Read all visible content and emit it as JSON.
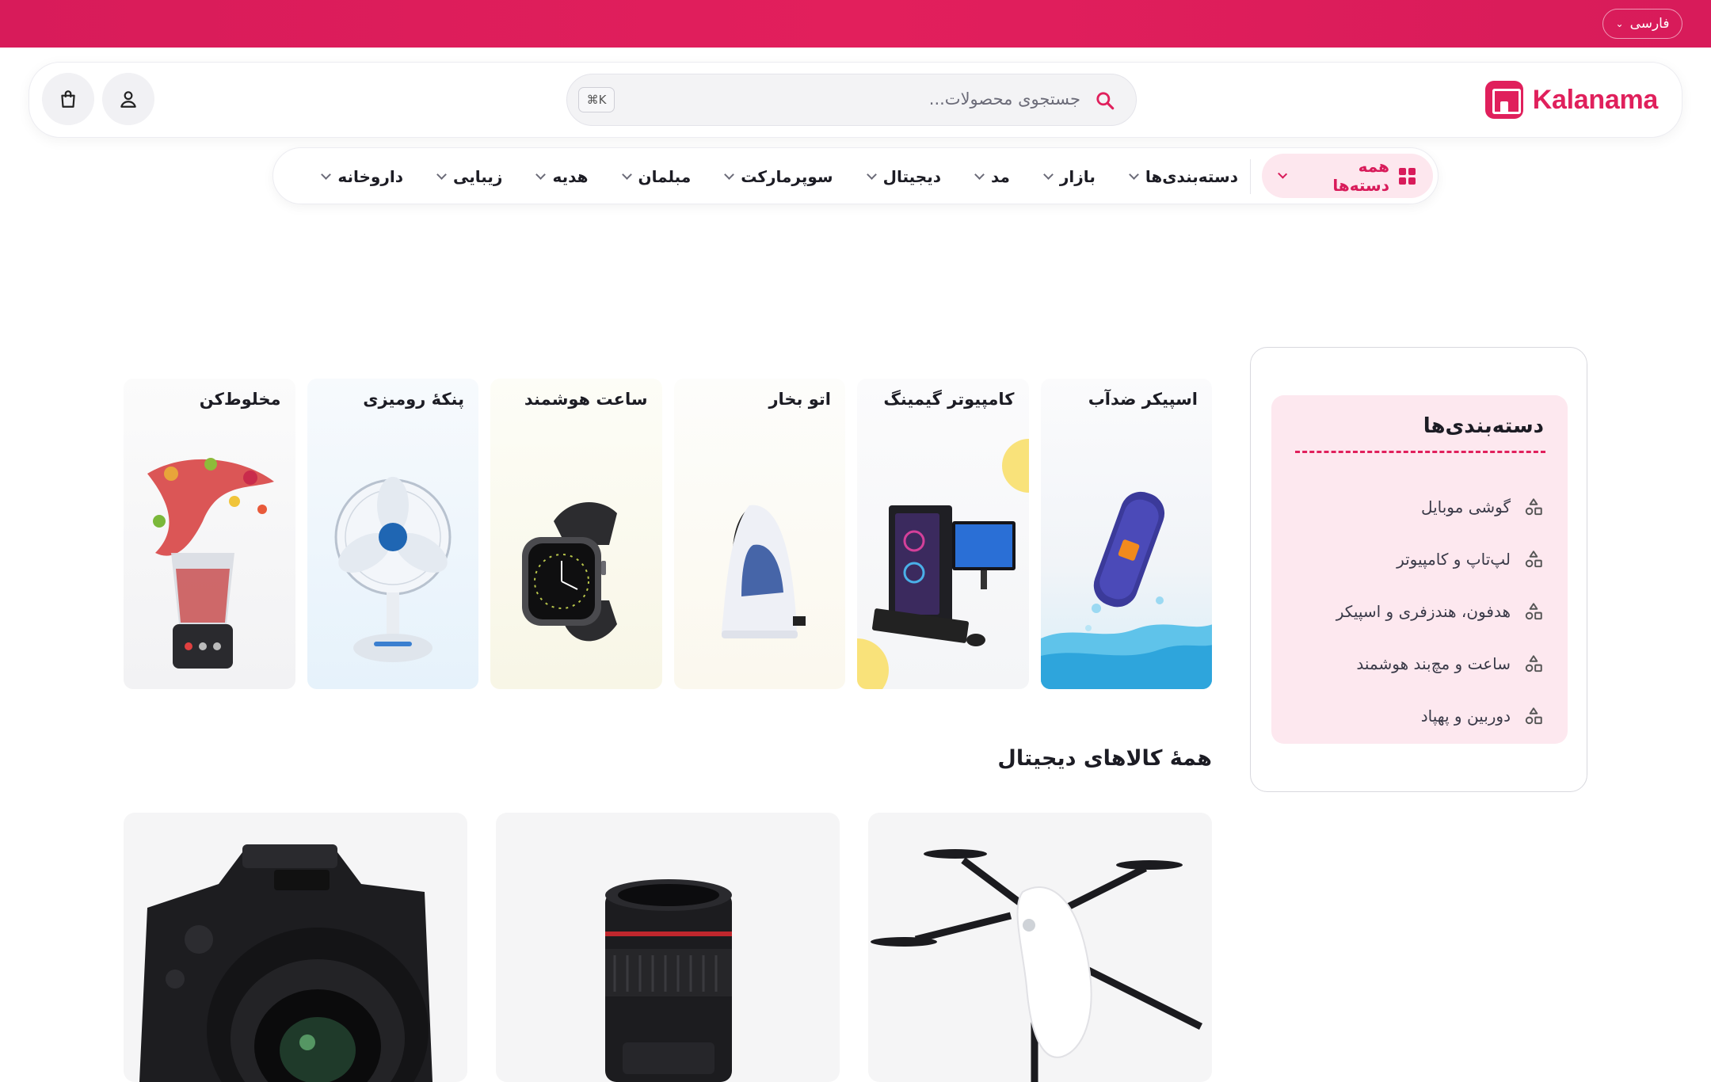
{
  "topbar": {
    "language": "فارسی",
    "accent": "#e0205c"
  },
  "header": {
    "brand": "Kalanama",
    "search_placeholder": "جستجوی محصولات...",
    "search_shortcut": "⌘K",
    "icons": [
      "search-icon",
      "user-icon",
      "shopping-bag-icon"
    ]
  },
  "nav": {
    "all_categories": "همه دسته‌ها",
    "items": [
      "دسته‌بندی‌ها",
      "بازار",
      "مد",
      "دیجیتال",
      "سوپرمارکت",
      "مبلمان",
      "هدیه",
      "زیبایی",
      "داروخانه"
    ]
  },
  "sidebar": {
    "title": "دسته‌بندی‌ها",
    "items": [
      "گوشی موبایل",
      "لپ‌تاپ و کامپیوتر",
      "هدفون، هندزفری و اسپیکر",
      "ساعت و مچ‌بند هوشمند",
      "دوربین و پهپاد"
    ]
  },
  "categories": [
    "اسپیکر ضدآب",
    "کامپیوتر گیمینگ",
    "اتو بخار",
    "ساعت هوشمند",
    "پنکهٔ رومیزی",
    "مخلوط‌کن"
  ],
  "section": {
    "title": "همهٔ کالاهای دیجیتال"
  }
}
